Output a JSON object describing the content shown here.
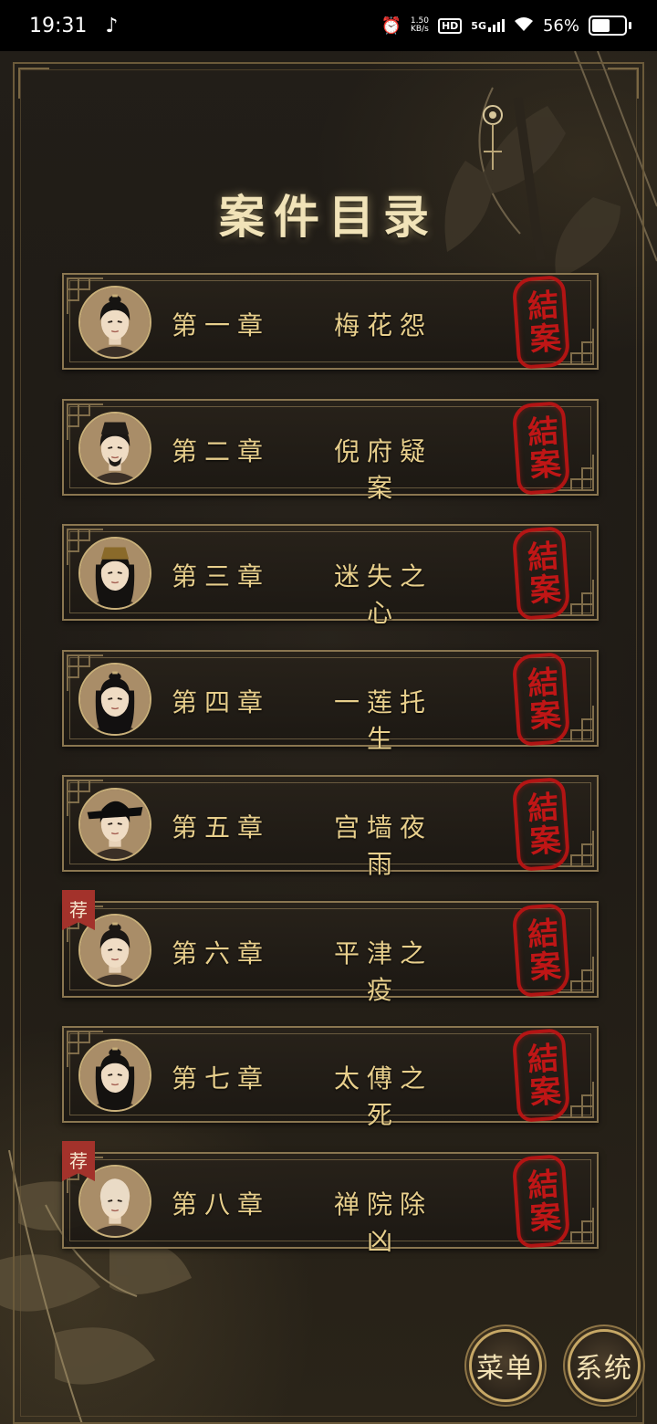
{
  "status_bar": {
    "time": "19:31",
    "net_speed_value": "1.50",
    "net_speed_unit": "KB/s",
    "hd": "HD",
    "signal": "5G",
    "battery": "56%",
    "battery_level": 0.56
  },
  "page": {
    "title": "案件目录"
  },
  "chapters": [
    {
      "number": "第一章",
      "title": "梅花怨",
      "stamp": "結案",
      "avatar": "avatar-young-man-topknot"
    },
    {
      "number": "第二章",
      "title": "倪府疑案",
      "stamp": "結案",
      "avatar": "avatar-bearded-official"
    },
    {
      "number": "第三章",
      "title": "迷失之心",
      "stamp": "結案",
      "avatar": "avatar-long-hair-man"
    },
    {
      "number": "第四章",
      "title": "一莲托生",
      "stamp": "結案",
      "avatar": "avatar-woman"
    },
    {
      "number": "第五章",
      "title": "宫墙夜雨",
      "stamp": "結案",
      "avatar": "avatar-eunuch-hat"
    },
    {
      "number": "第六章",
      "title": "平津之疫",
      "stamp": "結案",
      "badge": "荐",
      "avatar": "avatar-young-man"
    },
    {
      "number": "第七章",
      "title": "太傅之死",
      "stamp": "結案",
      "avatar": "avatar-scholar"
    },
    {
      "number": "第八章",
      "title": "禅院除凶",
      "stamp": "結案",
      "badge": "荐",
      "avatar": "avatar-monk"
    }
  ],
  "buttons": {
    "menu": "菜单",
    "system": "系统"
  },
  "colors": {
    "gold_text": "#e8cf8c",
    "stamp_red": "#c81616",
    "badge_red": "#a3322b",
    "frame_gold": "#8a7650"
  }
}
